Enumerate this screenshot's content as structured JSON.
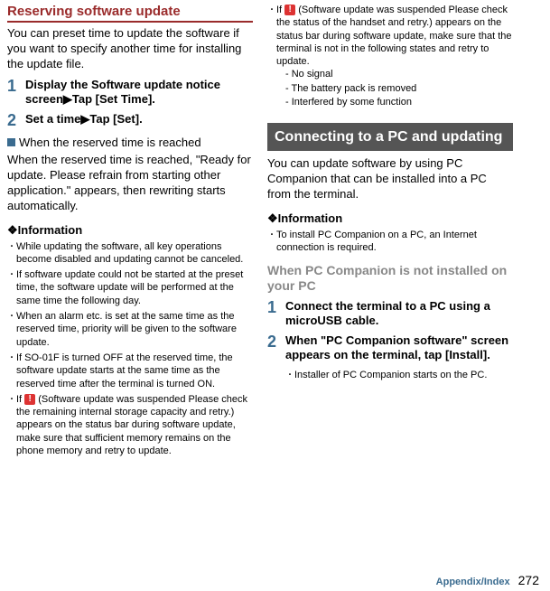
{
  "col1": {
    "heading": "Reserving software update",
    "intro": "You can preset time to update the software if you want to specify another time for installing the update file.",
    "step1_num": "1",
    "step1_text_a": "Display the Software update notice screen",
    "step1_text_b": "Tap [Set Time].",
    "step2_num": "2",
    "step2_text_a": "Set a time",
    "step2_text_b": "Tap [Set].",
    "sq_heading": "When the reserved time is reached",
    "sq_body": "When the reserved time is reached, \"Ready for update. Please refrain from starting other application.\" appears, then rewriting starts automatically.",
    "info_label": "❖Information",
    "b1": "While updating the software, all key operations become disabled and updating cannot be canceled.",
    "b2": "If software update could not be started at the preset time, the software update will be performed at the same time the following day.",
    "b3": "When an alarm etc. is set at the same time as the reserved time, priority will be given to the software update.",
    "b4": "If SO-01F is turned OFF at the reserved time, the software update starts at the same time as the reserved time after the terminal is turned ON.",
    "b5_a": "If ",
    "b5_icon": "!",
    "b5_b": " (Software update was suspended Please check the remaining internal storage capacity and retry.) appears on the status bar during software update, make sure that sufficient memory remains on the phone memory and retry to update."
  },
  "col2": {
    "t1_a": "If ",
    "t1_icon": "!",
    "t1_b": " (Software update was suspended Please check the status of the handset and retry.) appears on the status bar during software update, make sure that the terminal is not in the following states and retry to update.",
    "d1": "-  No signal",
    "d2": "-  The battery pack is removed",
    "d3": "-  Interfered by some function",
    "connect_h": "Connecting to a PC and updating",
    "connect_body": "You can update software by using PC Companion that can be installed into a PC from the terminal.",
    "info_label": "❖Information",
    "info_b1": "To install PC Companion on a PC, an Internet connection is required.",
    "gray_h": "When PC Companion is not installed on your PC",
    "s1_num": "1",
    "s1_text": "Connect the terminal to a PC using a microUSB cable.",
    "s2_num": "2",
    "s2_text": "When \"PC Companion software\" screen appears on the terminal, tap [Install].",
    "s2_sub": "Installer of PC Companion starts on the PC."
  },
  "footer": {
    "label": "Appendix/Index",
    "page": "272"
  },
  "arrow": "▶"
}
